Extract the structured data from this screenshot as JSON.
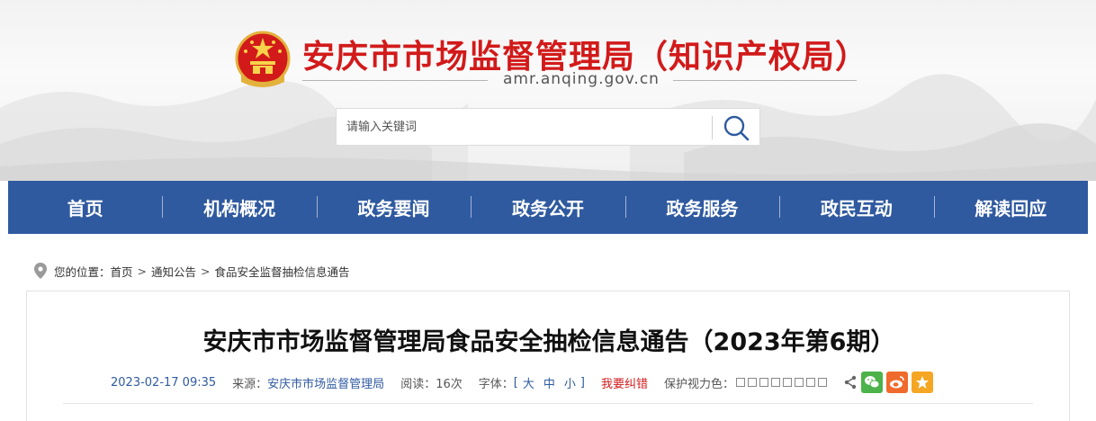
{
  "header": {
    "site_title": "安庆市市场监督管理局（知识产权局）",
    "domain": "amr.anqing.gov.cn"
  },
  "search": {
    "placeholder": "请输入关键词",
    "value": ""
  },
  "nav": {
    "items": [
      "首页",
      "机构概况",
      "政务要闻",
      "政务公开",
      "政务服务",
      "政民互动",
      "解读回应"
    ]
  },
  "breadcrumb": {
    "prefix": "您的位置：",
    "items": [
      "首页",
      "通知公告",
      "食品安全监督抽检信息通告"
    ],
    "separator": ">"
  },
  "article": {
    "title": "安庆市市场监督管理局食品安全抽检信息通告（2023年第6期）",
    "datetime": "2023-02-17 09:35",
    "source_label": "来源：",
    "source": "安庆市市场监督管理局",
    "views_label": "阅读：",
    "views": "16次",
    "font_label": "字体：",
    "font_open": "[",
    "font_close": "]",
    "font_sizes": [
      "大",
      "中",
      "小"
    ],
    "report_error": "我要纠错",
    "eye_care_label": "保护视力色："
  },
  "colors": {
    "brand_red": "#d21a1a",
    "nav_blue": "#2f5aa0",
    "wechat_green": "#4cb24a",
    "weibo_orange": "#ef6a2c",
    "favorite_yellow": "#f5a623",
    "eye_care_swatches": [
      "#ffffff",
      "#ffffff",
      "#ffffff",
      "#ffffff",
      "#ffffff",
      "#ffffff",
      "#ffffff",
      "#ffffff"
    ]
  },
  "icons": {
    "emblem": "national-emblem-icon",
    "search": "search-icon",
    "location": "location-pin-icon",
    "share": "share-icon",
    "wechat": "wechat-icon",
    "weibo": "weibo-icon",
    "favorite": "star-icon"
  }
}
